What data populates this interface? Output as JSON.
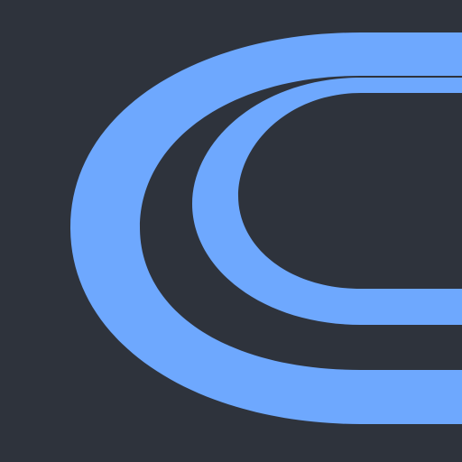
{
  "icon": {
    "semantic_name": "concentric-track-logo-icon",
    "background_color": "#2e333c",
    "accent_color": "#6ea8fe"
  }
}
